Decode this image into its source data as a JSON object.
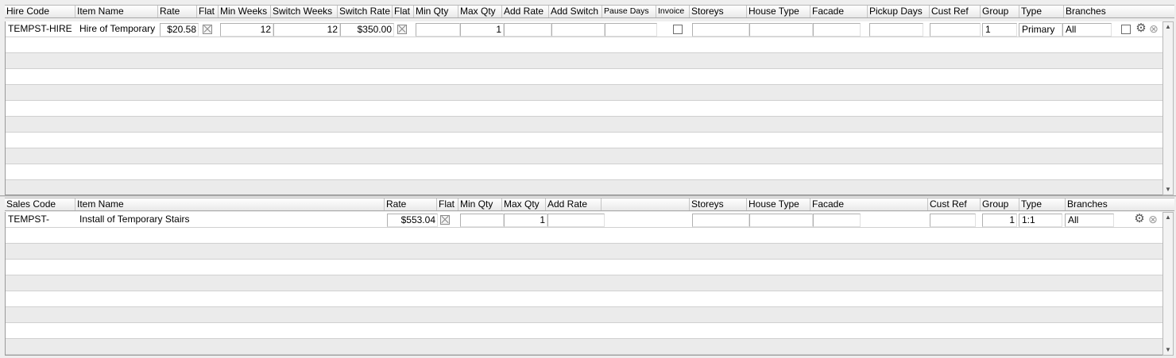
{
  "hire_table": {
    "headers": {
      "hire_code": "Hire Code",
      "item_name": "Item Name",
      "rate": "Rate",
      "flat": "Flat",
      "min_weeks": "Min Weeks",
      "switch_weeks": "Switch Weeks",
      "switch_rate": "Switch Rate",
      "flat2": "Flat",
      "min_qty": "Min Qty",
      "max_qty": "Max Qty",
      "add_rate": "Add Rate",
      "add_switch": "Add Switch",
      "pause_days": "Pause Days",
      "invoice": "Invoice",
      "storeys": "Storeys",
      "house_type": "House Type",
      "facade": "Facade",
      "pickup_days": "Pickup Days",
      "cust_ref": "Cust Ref",
      "group": "Group",
      "type": "Type",
      "branches": "Branches"
    },
    "row": {
      "hire_code": "TEMPST-HIRE",
      "item_name": "Hire of Temporary",
      "rate": "$20.58",
      "flat": false,
      "min_weeks": "12",
      "switch_weeks": "12",
      "switch_rate": "$350.00",
      "flat2": false,
      "min_qty": "",
      "max_qty": "1",
      "add_rate": "",
      "add_switch": "",
      "pause_days": "",
      "invoice": false,
      "storeys": "",
      "house_type": "",
      "facade": "",
      "pickup_days": "",
      "cust_ref": "",
      "group": "1",
      "type": "Primary",
      "branches": "All",
      "select": false
    }
  },
  "sales_table": {
    "headers": {
      "sales_code": "Sales Code",
      "item_name": "Item Name",
      "rate": "Rate",
      "flat": "Flat",
      "min_qty": "Min Qty",
      "max_qty": "Max Qty",
      "add_rate": "Add Rate",
      "storeys": "Storeys",
      "house_type": "House Type",
      "facade": "Facade",
      "cust_ref": "Cust Ref",
      "group": "Group",
      "type": "Type",
      "branches": "Branches"
    },
    "row": {
      "sales_code": "TEMPST-",
      "item_name": "Install of Temporary Stairs",
      "rate": "$553.04",
      "flat": false,
      "min_qty": "",
      "max_qty": "1",
      "add_rate": "",
      "storeys": "",
      "house_type": "",
      "facade": "",
      "cust_ref": "",
      "group": "1",
      "type": "1:1",
      "branches": "All"
    }
  },
  "icons": {
    "settings": "gear-icon",
    "remove": "close-circle-icon",
    "scroll_up": "arrow-up-icon",
    "scroll_down": "arrow-down-icon"
  }
}
